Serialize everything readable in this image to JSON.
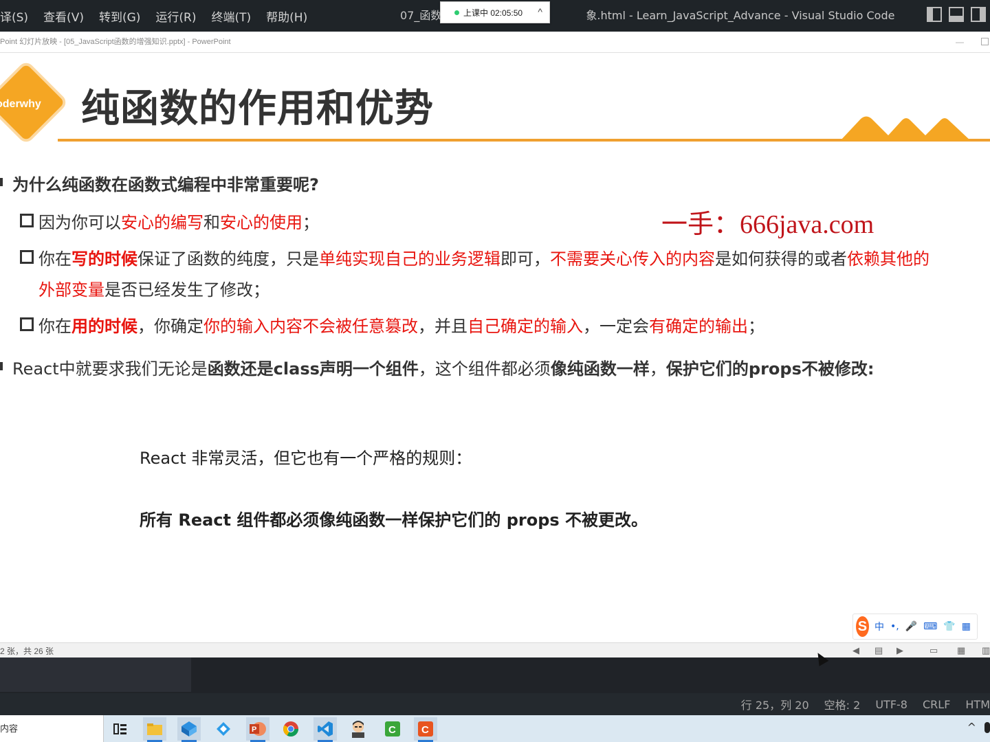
{
  "vscode": {
    "menu": [
      "译(S)",
      "查看(V)",
      "转到(G)",
      "运行(R)",
      "终端(T)",
      "帮助(H)"
    ],
    "title_left": "07_函数",
    "title_right": "象.html - Learn_JavaScript_Advance - Visual Studio Code",
    "status": {
      "position": "行 25，列 20",
      "spaces": "空格: 2",
      "encoding": "UTF-8",
      "eol": "CRLF",
      "language": "HTM"
    }
  },
  "class_timer": {
    "text": "上课中 02:05:50",
    "chevron": "^"
  },
  "ppt": {
    "window_title": "Point 幻灯片放映 - [05_JavaScript函数的增强知识.pptx] - PowerPoint",
    "status_page": "2 张，共 26 张"
  },
  "slide": {
    "logo_text": "oderwhy",
    "title": "纯函数的作用和优势",
    "watermark": "一手：666java.com",
    "q1": "为什么纯函数在函数式编程中非常重要呢?",
    "s1": {
      "a": "因为你可以",
      "b": "安心的编写",
      "c": "和",
      "d": "安心的使用",
      "e": "；"
    },
    "s2": {
      "a": "你在",
      "b": "写的时候",
      "c": "保证了函数的纯度，只是",
      "d": "单纯实现自己的业务逻辑",
      "e": "即可，",
      "f": "不需要关心传入的内容",
      "g": "是如何获得的或者",
      "h": "依赖其他的",
      "i": "外部变量",
      "j": "是否已经发生了修改；"
    },
    "s3": {
      "a": "你在",
      "b": "用的时候",
      "c": "，你确定",
      "d": "你的输入内容不会被任意篡改",
      "e": "，并且",
      "f": "自己确定的输入",
      "g": "，一定会",
      "h": "有确定的输出",
      "i": "；"
    },
    "q2": {
      "a": "React中就要求我们无论是",
      "b": "函数还是class声明一个组件",
      "c": "，这个组件都必须",
      "d": "像纯函数一样",
      "e": "，",
      "f": "保护它们的props不被修改:"
    },
    "quote_line1": "React 非常灵活，但它也有一个严格的规则：",
    "quote_line2": "所有 React 组件都必须像纯函数一样保护它们的 props 不被更改。"
  },
  "ime": {
    "logo": "S",
    "icons": [
      "中",
      "•,",
      "🎤",
      "⌨",
      "👕",
      "▦"
    ]
  },
  "taskbar": {
    "search_text": "内容"
  },
  "colors": {
    "accent": "#f5a623",
    "emphasis": "#e8150f",
    "watermark": "#c0141a"
  }
}
